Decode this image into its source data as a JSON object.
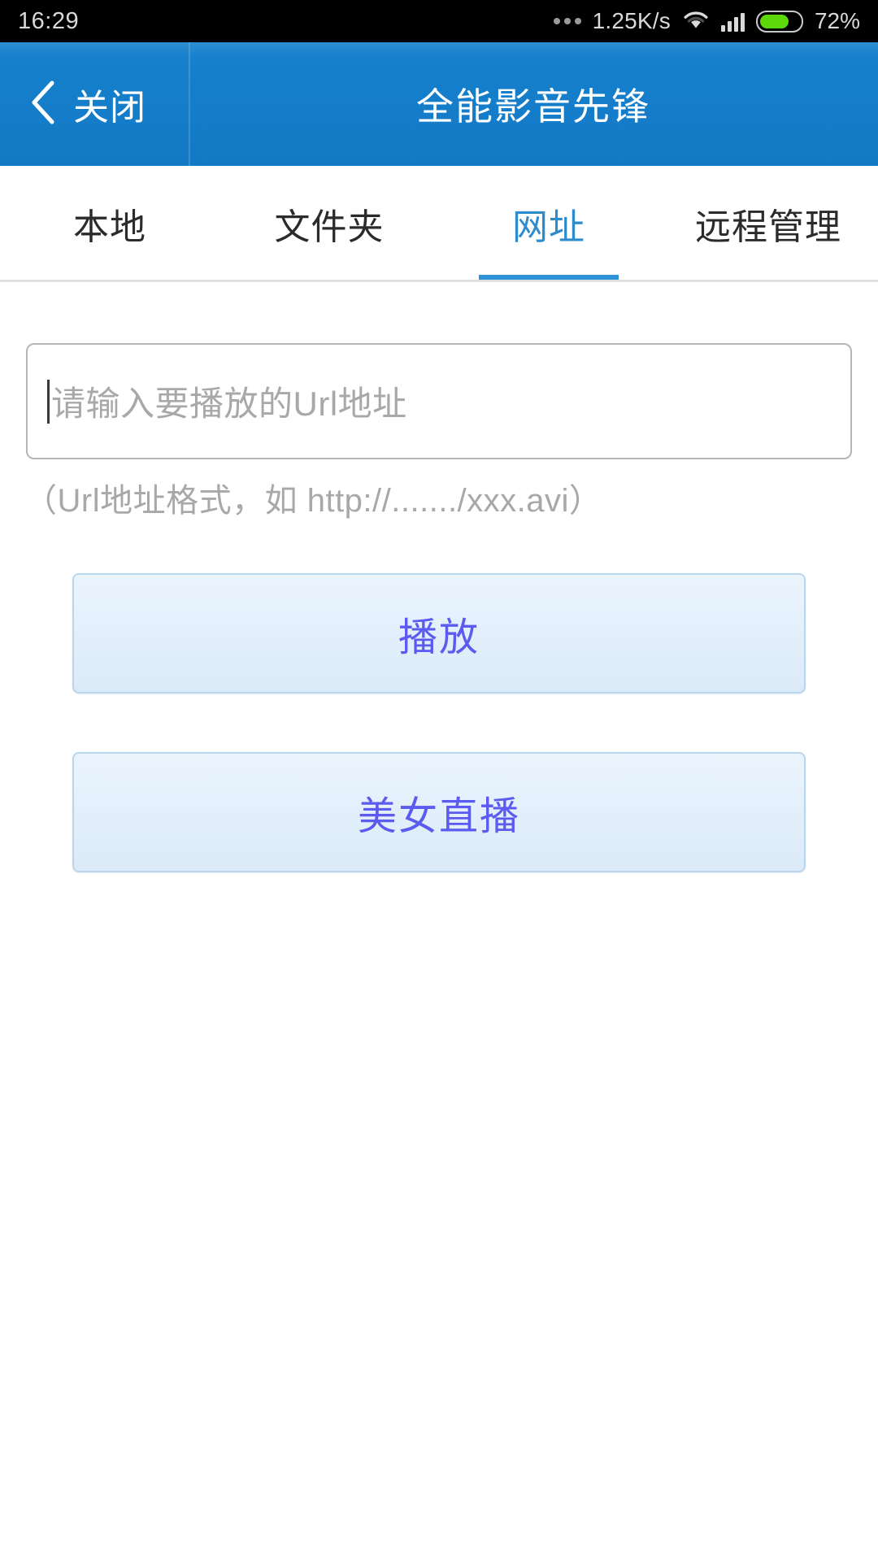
{
  "status_bar": {
    "clock": "16:29",
    "network_speed": "1.25K/s",
    "battery_percent": "72%",
    "battery_level": 72,
    "icons": {
      "more": "more-dots-icon",
      "wifi": "wifi-icon",
      "signal": "cellular-signal-icon",
      "battery": "battery-icon"
    },
    "colors": {
      "background": "#000000",
      "text": "#d9d9d9",
      "battery_fill": "#5dd80a"
    }
  },
  "header": {
    "back_label": "关闭",
    "back_icon": "chevron-left-icon",
    "title": "全能影音先锋",
    "colors": {
      "background": "#1680cd",
      "text": "#ffffff"
    }
  },
  "tabs": [
    {
      "label": "本地",
      "active": false
    },
    {
      "label": "文件夹",
      "active": false
    },
    {
      "label": "网址",
      "active": true
    },
    {
      "label": "远程管理",
      "active": false
    }
  ],
  "tabbar": {
    "active_index": 2,
    "colors": {
      "active_text": "#2e8ccd",
      "inactive_text": "#2b2b2b",
      "underline": "#2e93d6",
      "separator": "#e0e0e0"
    }
  },
  "main": {
    "url_input": {
      "value": "",
      "placeholder": "请输入要播放的Url地址"
    },
    "url_hint": "（Url地址格式，如 http://......./xxx.avi）",
    "buttons": [
      {
        "label": "播放",
        "name": "play-button"
      },
      {
        "label": "美女直播",
        "name": "live-stream-button"
      }
    ],
    "colors": {
      "button_text": "#5b5bef",
      "button_border": "#b9d6ec",
      "button_fill_top": "#eaf4fd",
      "button_fill_bottom": "#dbeaf8",
      "placeholder_text": "#a8a8a8",
      "input_border": "#b6b6b6"
    }
  }
}
